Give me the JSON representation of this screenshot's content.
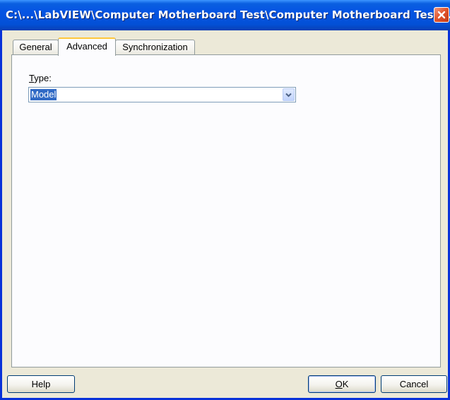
{
  "window": {
    "title": "C:\\...\\LabVIEW\\Computer Motherboard Test\\Computer Motherboard Test..."
  },
  "tabs": [
    {
      "label": "General",
      "active": false
    },
    {
      "label": "Advanced",
      "active": true
    },
    {
      "label": "Synchronization",
      "active": false
    }
  ],
  "advanced": {
    "type_label_mnemonic": "T",
    "type_label_rest": "ype:",
    "type_value": "Model"
  },
  "buttons": {
    "help": "Help",
    "ok_mnemonic": "O",
    "ok_rest": "K",
    "cancel": "Cancel"
  },
  "colors": {
    "titlebar": "#0554e3",
    "close_button": "#e2572f",
    "selection": "#316ac5",
    "active_tab_accent": "#ffc73c"
  },
  "icons": {
    "close": "close-x-icon",
    "dropdown": "chevron-down-icon"
  }
}
